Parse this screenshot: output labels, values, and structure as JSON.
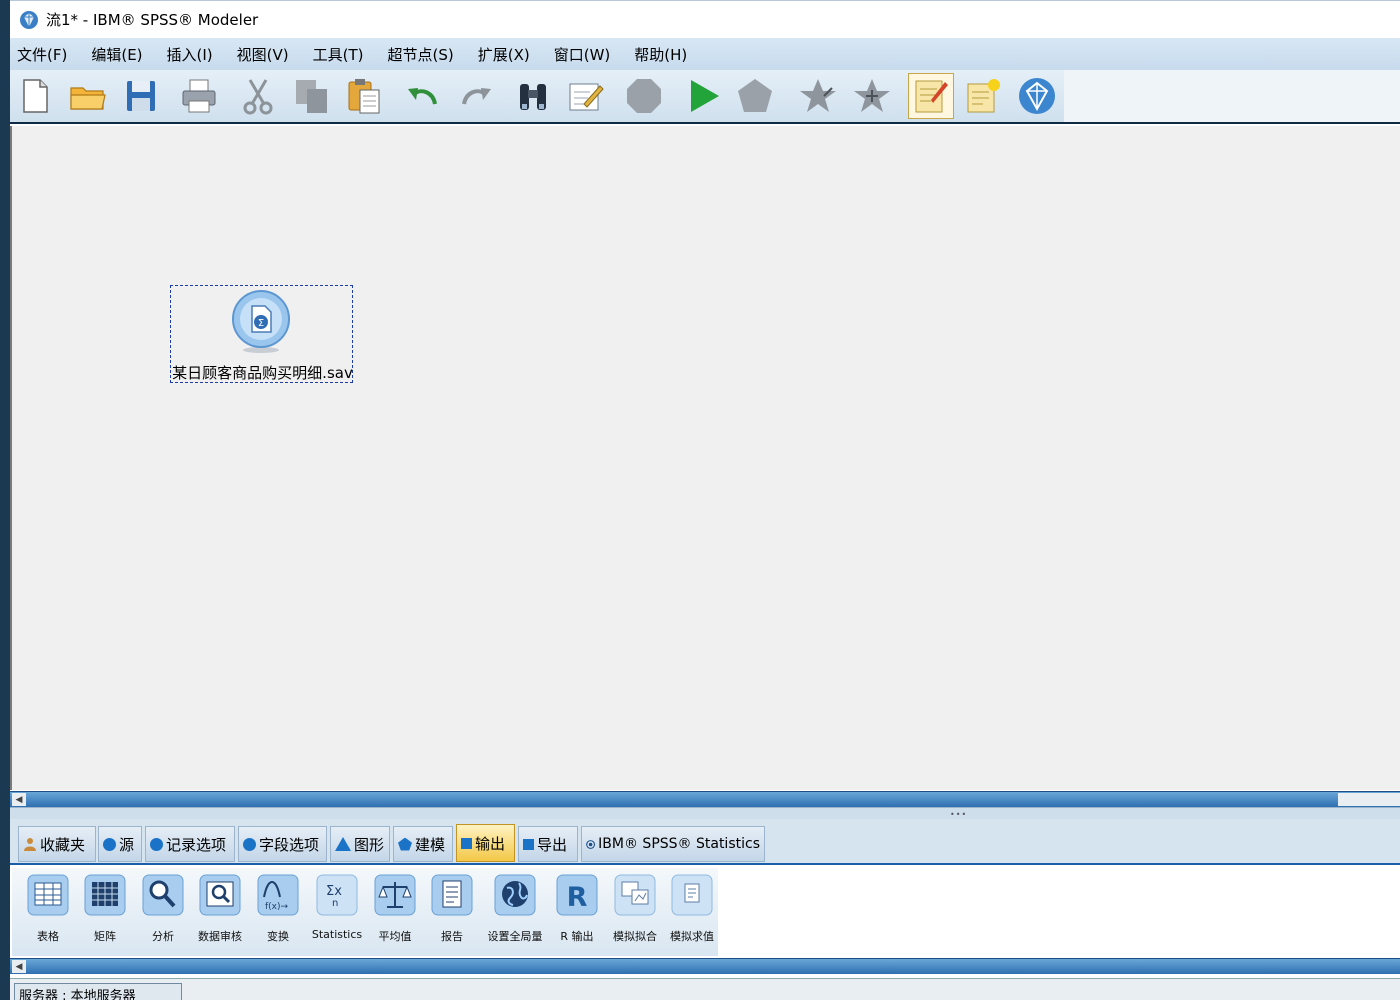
{
  "window": {
    "title": "流1* - IBM® SPSS® Modeler"
  },
  "menu": [
    "文件(F)",
    "编辑(E)",
    "插入(I)",
    "视图(V)",
    "工具(T)",
    "超节点(S)",
    "扩展(X)",
    "窗口(W)",
    "帮助(H)"
  ],
  "toolbar": {
    "buttons": [
      "new-stream",
      "open-stream",
      "save-stream",
      "print",
      "cut",
      "copy",
      "paste",
      "undo",
      "redo",
      "search",
      "edit-annotation",
      "stop",
      "run",
      "run-selection",
      "zoom-in-supernode",
      "zoom-out-supernode",
      "annotation-toggle",
      "new-comment",
      "insight"
    ]
  },
  "canvas": {
    "nodes": [
      {
        "label": "某日顾客商品购买明细.sav",
        "icon": "statistics-file-source-icon"
      }
    ]
  },
  "palette": {
    "tabs": [
      {
        "label": "收藏夹",
        "icon": "person-icon"
      },
      {
        "label": "源",
        "icon": "circle-icon"
      },
      {
        "label": "记录选项",
        "icon": "circle-icon"
      },
      {
        "label": "字段选项",
        "icon": "circle-icon"
      },
      {
        "label": "图形",
        "icon": "triangle-icon"
      },
      {
        "label": "建模",
        "icon": "pentagon-icon"
      },
      {
        "label": "输出",
        "icon": "square-icon",
        "active": true
      },
      {
        "label": "导出",
        "icon": "square-icon"
      },
      {
        "label": "IBM® SPSS® Statistics",
        "icon": "spss-icon"
      }
    ],
    "nodes": [
      {
        "label": "表格",
        "icon": "table-icon"
      },
      {
        "label": "矩阵",
        "icon": "matrix-icon"
      },
      {
        "label": "分析",
        "icon": "magnifier-icon"
      },
      {
        "label": "数据审核",
        "icon": "data-audit-icon"
      },
      {
        "label": "变换",
        "icon": "transform-icon"
      },
      {
        "label": "Statistics",
        "icon": "statistics-icon"
      },
      {
        "label": "平均值",
        "icon": "scale-icon"
      },
      {
        "label": "报告",
        "icon": "report-icon"
      },
      {
        "label": "设置全局量",
        "icon": "globe-icon"
      },
      {
        "label": "R 输出",
        "icon": "r-icon"
      },
      {
        "label": "模拟拟合",
        "icon": "sim-fit-icon"
      },
      {
        "label": "模拟求值",
        "icon": "sim-eval-icon"
      }
    ]
  },
  "manager": {
    "label": "服务器 : 本地服务器"
  },
  "colors": {
    "accent": "#1a73c7",
    "active_tab": "#f3c847",
    "frame": "#1b3a52"
  }
}
